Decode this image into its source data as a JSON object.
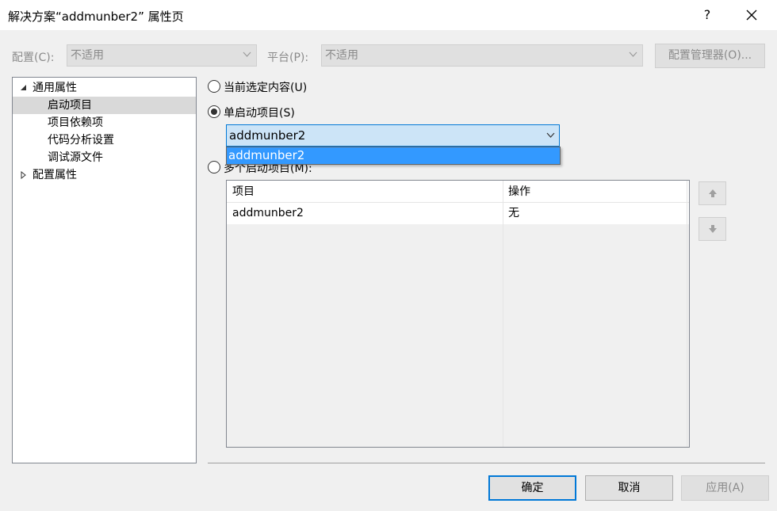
{
  "window": {
    "title": "解决方案“addmunber2” 属性页",
    "help_label": "?"
  },
  "config_row": {
    "config_label": "配置(C):",
    "config_value": "不适用",
    "platform_label": "平台(P):",
    "platform_value": "不适用",
    "config_manager_label": "配置管理器(O)..."
  },
  "tree": {
    "items": [
      {
        "label": "通用属性",
        "expander": "expanded"
      },
      {
        "label": "启动项目",
        "selected": true
      },
      {
        "label": "项目依赖项"
      },
      {
        "label": "代码分析设置"
      },
      {
        "label": "调试源文件"
      },
      {
        "label": "配置属性",
        "expander": "collapsed"
      }
    ]
  },
  "startup": {
    "option_current_label": "当前选定内容(U)",
    "option_single_label": "单启动项目(S)",
    "option_multiple_label": "多个启动项目(M):",
    "selected_option": "single",
    "single_project_value": "addmunber2",
    "dropdown_options": [
      "addmunber2"
    ]
  },
  "multi_table": {
    "headers": [
      "项目",
      "操作"
    ],
    "rows": [
      [
        "addmunber2",
        "无"
      ]
    ]
  },
  "footer": {
    "ok_label": "确定",
    "cancel_label": "取消",
    "apply_label": "应用(A)"
  },
  "colors": {
    "accent": "#0078d7",
    "selection_blue": "#3399ff",
    "combo_focus_bg": "#cce4f7",
    "disabled_text": "#8a8a8a"
  }
}
